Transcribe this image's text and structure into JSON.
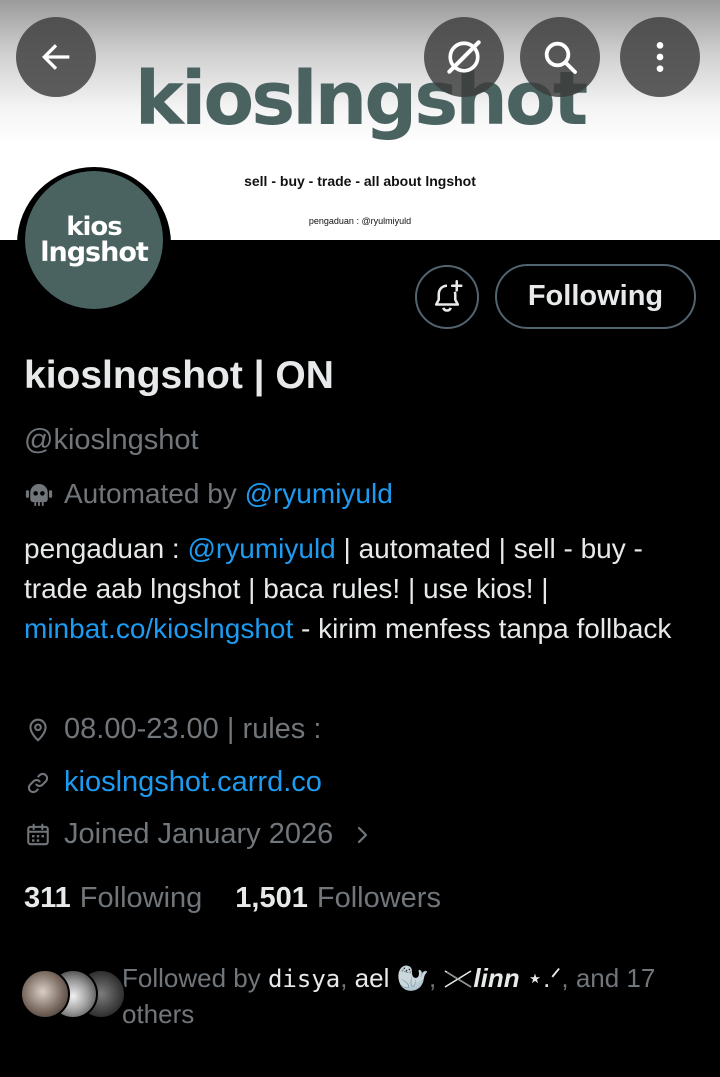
{
  "banner": {
    "title": "kioslngshot",
    "tagline": "sell - buy - trade - all about lngshot",
    "contact": "pengaduan : @ryulmiyuld"
  },
  "top_bar": {
    "back_icon": "arrow-left-icon",
    "grok_icon": "grok-icon",
    "search_icon": "search-icon",
    "more_icon": "more-vertical-icon"
  },
  "avatar": {
    "line1": "kios",
    "line2": "lngshot",
    "color": "#4a6361"
  },
  "actions": {
    "notify_icon": "bell-plus-icon",
    "follow_label": "Following"
  },
  "profile": {
    "name": "kioslngshot | ON",
    "handle": "@kioslngshot",
    "automated_prefix": "Automated by",
    "automated_by": "@ryumiyuld",
    "bio": {
      "p1": "pengaduan : ",
      "mention": "@ryumiyuld",
      "p2": " | automated | sell - buy - trade aab lngshot | baca rules! | use kios! | ",
      "link": "minbat.co/kioslngshot",
      "p3": " - kirim menfess tanpa follback"
    },
    "location": "08.00-23.00 | rules :",
    "website": "kioslngshot.carrd.co",
    "joined": "Joined January 2026"
  },
  "stats": {
    "following_count": "311",
    "following_label": "Following",
    "followers_count": "1,501",
    "followers_label": "Followers"
  },
  "followed_by": {
    "prefix": "Followed by ",
    "user1": "disya",
    "sep1": ", ",
    "user2": "ael 🦭",
    "sep2": ", ",
    "user3": "linn",
    "user3_suffix": " ⋆.ᐟ",
    "suffix": ", and 17 others"
  },
  "colors": {
    "link": "#1d9bf0",
    "muted": "#71767b",
    "text": "#e7e9ea",
    "border": "#536471"
  }
}
